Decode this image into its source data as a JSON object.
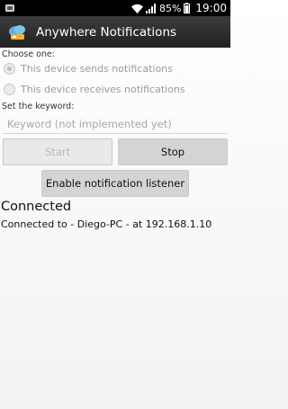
{
  "status_bar": {
    "battery": "85%",
    "time": "19:00",
    "icons": [
      "notification-icon",
      "wifi-icon",
      "signal-icon",
      "battery-icon"
    ]
  },
  "action_bar": {
    "title": "Anywhere Notifications",
    "icon": "app-icon"
  },
  "mode": {
    "label": "Choose one:",
    "options": [
      {
        "label": "This device sends notifications",
        "checked": true
      },
      {
        "label": "This device receives notifications",
        "checked": false
      }
    ]
  },
  "keyword": {
    "label": "Set the keyword:",
    "placeholder": "Keyword (not implemented yet)"
  },
  "buttons": {
    "start": "Start",
    "stop": "Stop",
    "enable_listener": "Enable notification listener"
  },
  "connection": {
    "title": "Connected",
    "detail": "Connected to - Diego-PC - at 192.168.1.10"
  }
}
